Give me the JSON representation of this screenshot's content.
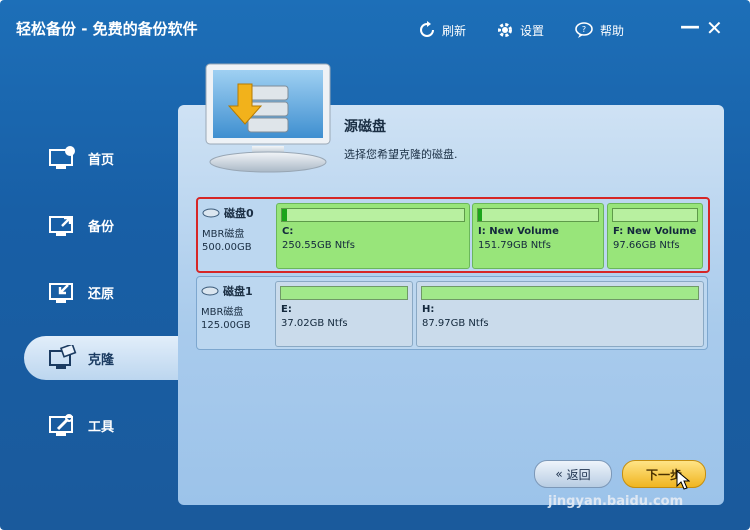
{
  "window": {
    "title": "轻松备份 - 免费的备份软件",
    "toolbar": [
      {
        "label": "刷新",
        "icon": "refresh-icon"
      },
      {
        "label": "设置",
        "icon": "gear-icon"
      },
      {
        "label": "帮助",
        "icon": "help-icon"
      }
    ],
    "minimize_glyph": "—",
    "close_glyph": "✕"
  },
  "sidebar": {
    "items": [
      {
        "label": "首页",
        "icon": "home-icon",
        "active": false
      },
      {
        "label": "备份",
        "icon": "backup-icon",
        "active": false
      },
      {
        "label": "还原",
        "icon": "restore-icon",
        "active": false
      },
      {
        "label": "克隆",
        "icon": "clone-icon",
        "active": true
      },
      {
        "label": "工具",
        "icon": "tools-icon",
        "active": false
      }
    ]
  },
  "main": {
    "title": "源磁盘",
    "subtitle": "选择您希望克隆的磁盘.",
    "disks": [
      {
        "name": "磁盘0",
        "type": "MBR磁盘",
        "size": "500.00GB",
        "selected": true,
        "partitions": [
          {
            "letter": "C:",
            "size": "250.55GB Ntfs",
            "used_fraction": 0.03
          },
          {
            "letter": "I: New Volume",
            "size": "151.79GB Ntfs",
            "used_fraction": 0.03
          },
          {
            "letter": "F: New Volume",
            "size": "97.66GB Ntfs",
            "used_fraction": 0.0
          }
        ]
      },
      {
        "name": "磁盘1",
        "type": "MBR磁盘",
        "size": "125.00GB",
        "selected": false,
        "partitions": [
          {
            "letter": "E:",
            "size": "37.02GB Ntfs",
            "used_fraction": 0.0
          },
          {
            "letter": "H:",
            "size": "87.97GB Ntfs",
            "used_fraction": 0.0
          }
        ]
      }
    ]
  },
  "footer": {
    "back_label": "返回",
    "next_label": "下一步"
  },
  "watermark": "jingyan.baidu.com",
  "colors": {
    "accent": "#1d6fb8",
    "selection": "#d62626",
    "partition_green": "#98e57a",
    "next_button": "#f0b520"
  }
}
